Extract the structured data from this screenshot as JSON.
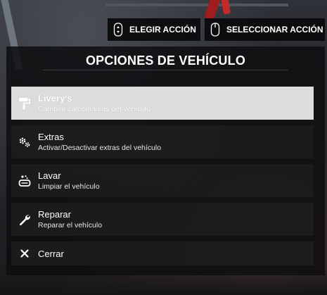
{
  "hints": [
    {
      "label": "ELEGIR ACCIÓN",
      "icon": "scroll-wheel-icon"
    },
    {
      "label": "SELECCIONAR ACCIÓN",
      "icon": "mouse-icon"
    }
  ],
  "menu": {
    "title": "OPCIONES DE VEHÍCULO",
    "items": [
      {
        "label": "Livery's",
        "description": "Cambiar calcomanías del vehículo",
        "icon": "paint-roller-icon",
        "selected": true
      },
      {
        "label": "Extras",
        "description": "Activar/Desactivar extras del vehículo",
        "icon": "gears-icon",
        "selected": false
      },
      {
        "label": "Lavar",
        "description": "Limpiar el vehículo",
        "icon": "soap-icon",
        "selected": false
      },
      {
        "label": "Reparar",
        "description": "Reparar el vehículo",
        "icon": "wrench-icon",
        "selected": false
      },
      {
        "label": "Cerrar",
        "icon": "close-icon",
        "selected": false
      }
    ]
  },
  "colors": {
    "panel_bg": "#0e0e10",
    "selected_bg": "#dcdcdc",
    "item_bg": "#1c1c1f",
    "text": "#ffffff"
  }
}
